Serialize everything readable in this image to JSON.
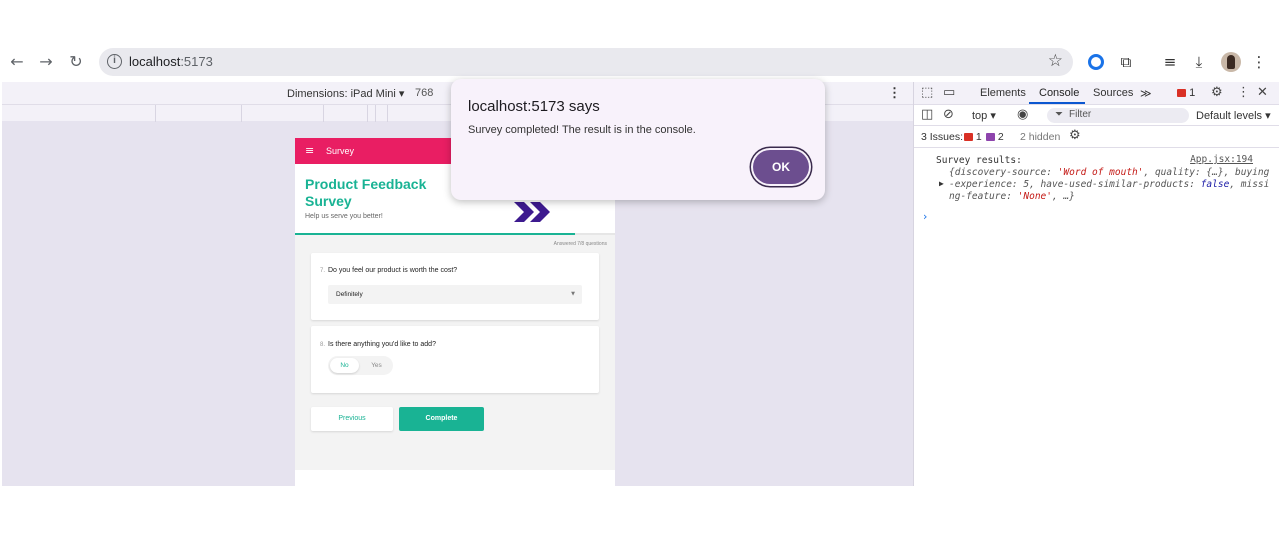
{
  "browser": {
    "url_host": "localhost",
    "url_port": ":5173"
  },
  "device_toolbar": {
    "dimensions_label": "Dimensions: iPad Mini",
    "width_value": "768"
  },
  "survey": {
    "header_title": "Survey",
    "title": "Product Feedback Survey",
    "description": "Help us  serve you better!",
    "progress_text": "Answered 7/8 questions",
    "progress_fraction": 0.875,
    "questions": [
      {
        "number": "7.",
        "title": "Do you feel our product is worth the cost?",
        "value": "Definitely"
      },
      {
        "number": "8.",
        "title": "Is there anything you'd like to add?",
        "option_no": "No",
        "option_yes": "Yes"
      }
    ],
    "previous_label": "Previous",
    "complete_label": "Complete",
    "colors": {
      "accent": "#19b394",
      "header": "#e91e63",
      "logo": "#3d1a8f"
    }
  },
  "devtools": {
    "tabs": [
      "Elements",
      "Console",
      "Sources"
    ],
    "active_tab": "Console",
    "error_count": "1",
    "context": "top",
    "filter_placeholder": "Filter",
    "levels": "Default levels",
    "issues_label": "3 Issues:",
    "issues_errors": "1",
    "issues_warnings": "2",
    "hidden_label": "2 hidden",
    "log": {
      "label": "Survey results:",
      "source": "App.jsx:194",
      "line1_open": "{",
      "line1_key1": "discovery-source",
      "line1_val1": "'Word of mouth'",
      "line1_key2": ", quality",
      "line1_val2": ": {…}, buying",
      "line2_key1": "-experience",
      "line2_val1": ": 5, ",
      "line2_key2": "have-used-similar-products",
      "line2_val2": ": ",
      "line2_bool": "false",
      "line2_tail": ", missi",
      "line3_key": "ng-feature",
      "line3_sep": ": ",
      "line3_val": "'None'",
      "line3_tail": ", …}"
    }
  },
  "dialog": {
    "title": "localhost:5173 says",
    "message": "Survey completed! The result is in the console.",
    "ok_label": "OK"
  }
}
